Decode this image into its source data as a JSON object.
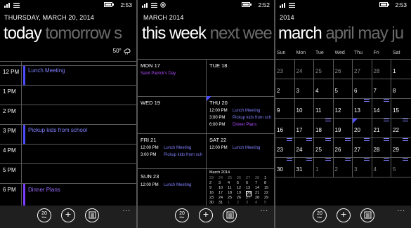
{
  "status": {
    "panel1_time": "2:53",
    "panel2_time": "2:52",
    "panel3_time": "2:53"
  },
  "panel1": {
    "date_header": "THURSDAY, MARCH 20, 2014",
    "pivot_active": "today",
    "pivot_next": "tomorrow",
    "pivot_next2": "s",
    "weather_temp": "50°",
    "hours": [
      "12 PM",
      "1 PM",
      "2 PM",
      "3 PM",
      "4 PM",
      "5 PM",
      "6 PM"
    ],
    "events": [
      "Lunch Meeting",
      "Pickup kids from school",
      "Dinner Plans"
    ]
  },
  "panel2": {
    "header": "MARCH 2014",
    "pivot_active": "this week",
    "pivot_next": "next wee",
    "days": {
      "mon": {
        "title": "MON 17",
        "note": "Saint Patrick's Day"
      },
      "tue": {
        "title": "TUE 18"
      },
      "wed": {
        "title": "WED 19"
      },
      "thu": {
        "title": "THU 20",
        "events": [
          {
            "time": "12:00 PM",
            "name": "Lunch Meeting"
          },
          {
            "time": "3:00 PM",
            "name": "Pickup kids from sch"
          },
          {
            "time": "6:00 PM",
            "name": "Dinner Plans"
          }
        ]
      },
      "fri": {
        "title": "FRI 21",
        "events": [
          {
            "time": "12:00 PM",
            "name": "Lunch Meeting"
          },
          {
            "time": "3:00 PM",
            "name": "Pickup kids from sch"
          }
        ]
      },
      "sat": {
        "title": "SAT 22",
        "events": [
          {
            "time": "12:00 PM",
            "name": "Lunch Meeting"
          }
        ]
      },
      "sun": {
        "title": "SUN 23",
        "events": [
          {
            "time": "12:00 PM",
            "name": "Lunch Meeting"
          }
        ]
      }
    },
    "mini_title": "March 2014",
    "mini_rows": [
      [
        "23",
        "24",
        "25",
        "26",
        "27",
        "28",
        "1"
      ],
      [
        "2",
        "3",
        "4",
        "5",
        "6",
        "7",
        "8"
      ],
      [
        "9",
        "10",
        "11",
        "12",
        "13",
        "14",
        "15"
      ],
      [
        "16",
        "17",
        "18",
        "19",
        "20",
        "21",
        "22"
      ],
      [
        "23",
        "24",
        "25",
        "26",
        "27",
        "28",
        "29"
      ],
      [
        "30",
        "31",
        "1",
        "2",
        "3",
        "4",
        "5"
      ]
    ]
  },
  "panel3": {
    "year": "2014",
    "pivot_active": "march",
    "pivot_next": "april",
    "pivot_next2": "may",
    "pivot_next3": "ju",
    "dow": [
      "Sun",
      "Mon",
      "Tue",
      "Wed",
      "Thu",
      "Fri",
      "Sat"
    ],
    "rows": [
      [
        "23",
        "24",
        "25",
        "26",
        "27",
        "28",
        "1"
      ],
      [
        "2",
        "3",
        "4",
        "5",
        "6",
        "7",
        "8"
      ],
      [
        "9",
        "10",
        "11",
        "12",
        "13",
        "14",
        "15"
      ],
      [
        "16",
        "17",
        "18",
        "19",
        "20",
        "21",
        "22"
      ],
      [
        "23",
        "24",
        "25",
        "26",
        "27",
        "28",
        "29"
      ],
      [
        "30",
        "31",
        "1",
        "2",
        "3",
        "4",
        "5"
      ]
    ]
  },
  "appbar": {
    "today_day": "20",
    "today_month": "Mar",
    "more": "..."
  },
  "colors": {
    "accent": "#4c4cff",
    "event_text": "#8080ff",
    "holiday": "#b04cff",
    "background": "#000000"
  }
}
